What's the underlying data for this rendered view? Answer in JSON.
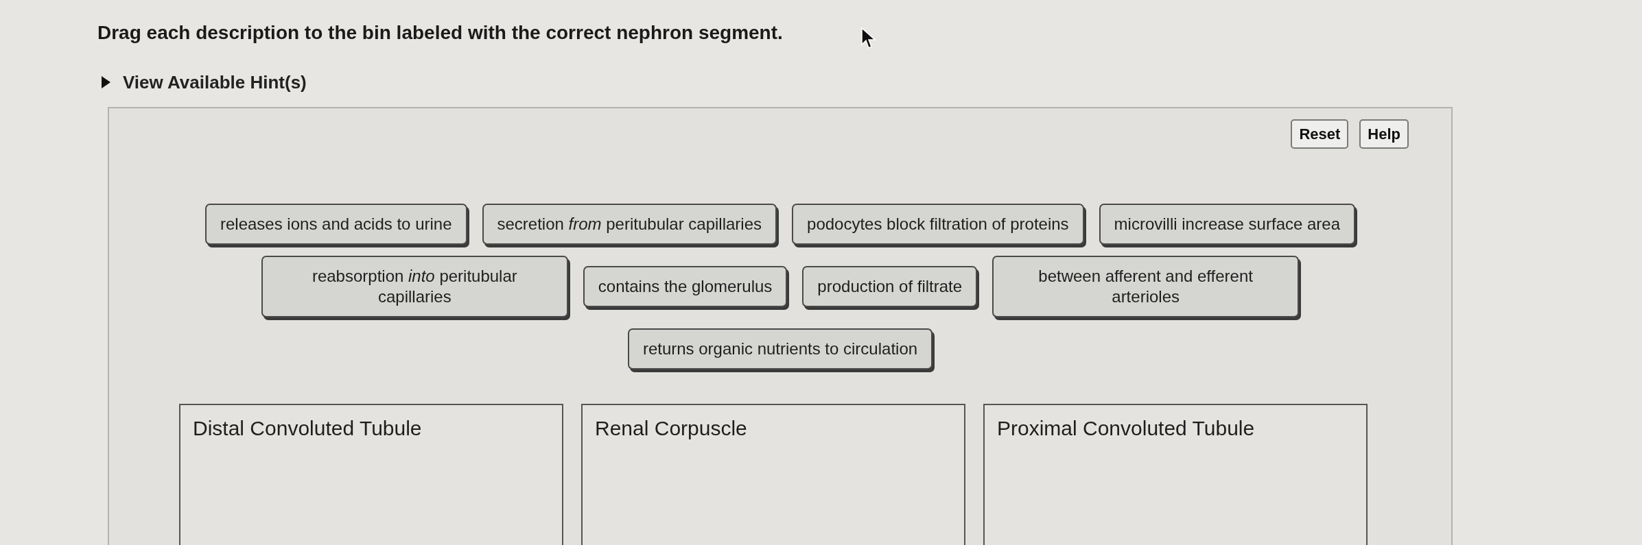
{
  "instruction": "Drag each description to the bin labeled with the correct nephron segment.",
  "hints": {
    "label": "View Available Hint(s)",
    "expanded": false
  },
  "buttons": [
    "Reset",
    "Help"
  ],
  "labels": [
    "releases ions and acids to urine",
    "secretion *from* peritubular capillaries",
    "podocytes block filtration of proteins",
    "microvilli increase surface area",
    "reabsorption *into* peritubular capillaries",
    "contains the glomerulus",
    "production of filtrate",
    "between afferent and efferent arterioles",
    "returns organic nutrients to circulation"
  ],
  "bins": [
    {
      "title": "Distal Convoluted Tubule"
    },
    {
      "title": "Renal Corpuscle"
    },
    {
      "title": "Proximal Convoluted Tubule"
    }
  ]
}
